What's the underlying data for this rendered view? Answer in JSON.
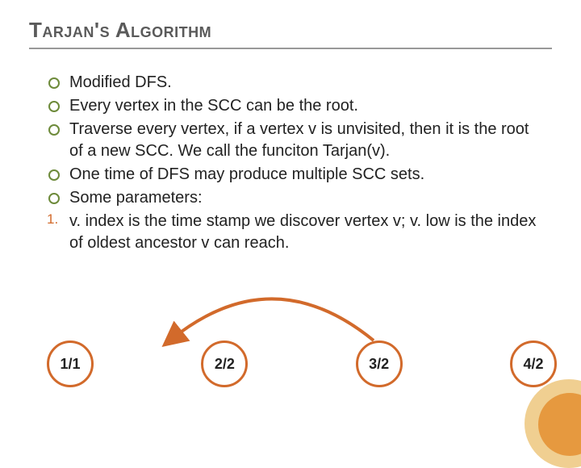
{
  "title": "Tarjan's Algorithm",
  "bullets": [
    "Modified DFS.",
    "Every vertex in the SCC can be the root.",
    "Traverse every vertex, if a vertex v is unvisited, then it is the root of a new SCC. We call the funciton Tarjan(v).",
    "One time of DFS may produce multiple SCC sets.",
    "Some parameters:"
  ],
  "numbered": {
    "marker": "1.",
    "text": "v. index is the time stamp we discover vertex v; v. low is the index of oldest ancestor v can reach."
  },
  "nodes": [
    "1/1",
    "2/2",
    "3/2",
    "4/2"
  ]
}
